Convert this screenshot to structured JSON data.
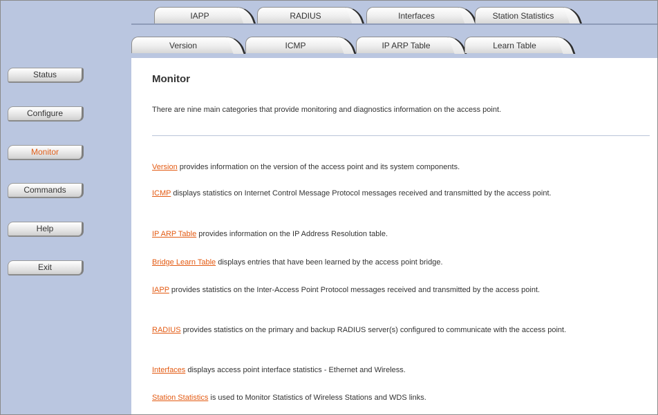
{
  "tabs": {
    "row1": [
      "IAPP",
      "RADIUS",
      "Interfaces",
      "Station Statistics"
    ],
    "row2": [
      "Version",
      "ICMP",
      "IP ARP Table",
      "Learn Table"
    ]
  },
  "sidebar": {
    "buttons": [
      "Status",
      "Configure",
      "Monitor",
      "Commands",
      "Help",
      "Exit"
    ],
    "active": "Monitor"
  },
  "main": {
    "title": "Monitor",
    "intro": "There are nine main categories that provide monitoring and diagnostics information on the access point.",
    "items": [
      {
        "link": "Version",
        "text": " provides information on the version of the access point and its system components."
      },
      {
        "link": "ICMP",
        "text": " displays statistics on Internet Control Message Protocol messages received and transmitted by the access point."
      },
      {
        "link": "IP ARP Table",
        "text": " provides information on the IP Address Resolution table."
      },
      {
        "link": "Bridge Learn Table",
        "text": " displays entries that have been learned by the access point bridge."
      },
      {
        "link": "IAPP",
        "text": " provides statistics on the Inter-Access Point Protocol messages received and transmitted by the access point."
      },
      {
        "link": "RADIUS",
        "text": " provides statistics on the primary and backup RADIUS server(s) configured to communicate with the access point."
      },
      {
        "link": "Interfaces",
        "text": " displays access point interface statistics - Ethernet and Wireless."
      },
      {
        "link": "Station Statistics",
        "text": " is used to Monitor Statistics of Wireless Stations and WDS links."
      }
    ]
  },
  "colors": {
    "sidebar_bg": "#bac6e0",
    "link": "#e35a12",
    "active_button_text": "#e0601c"
  }
}
